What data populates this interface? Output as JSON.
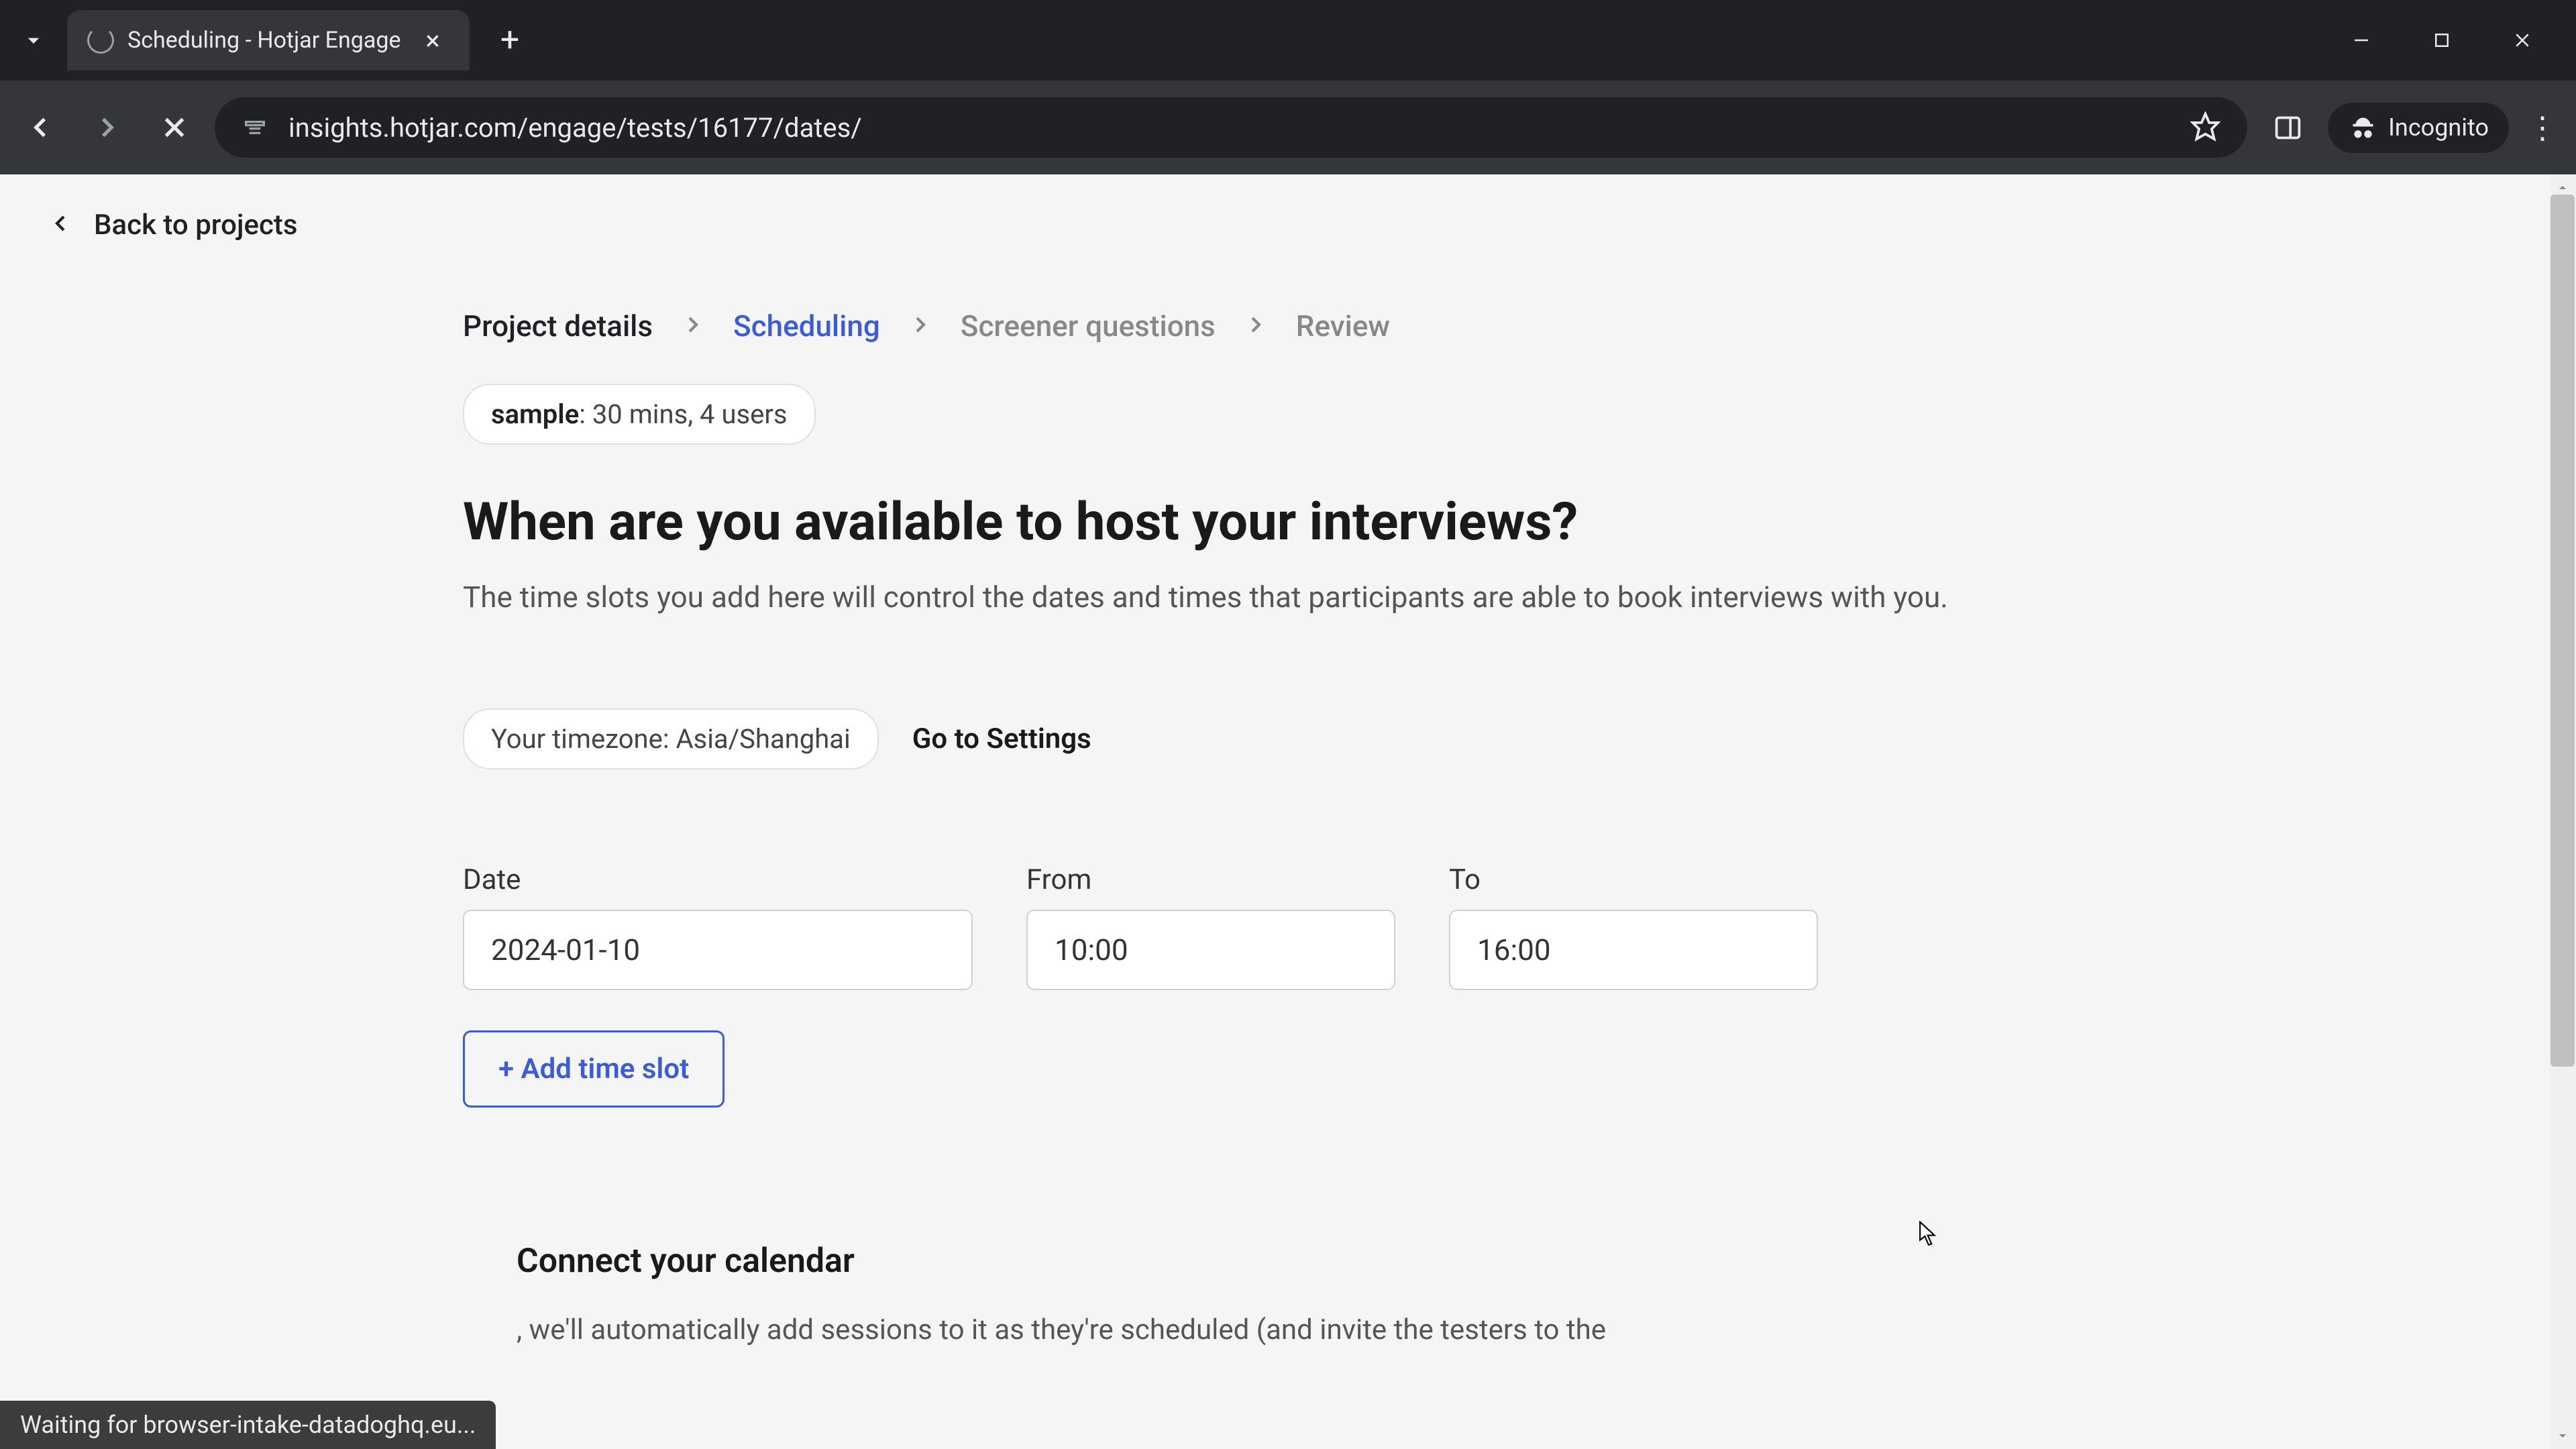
{
  "browser": {
    "tab_title": "Scheduling - Hotjar Engage",
    "url": "insights.hotjar.com/engage/tests/16177/dates/",
    "incognito_label": "Incognito",
    "status_text": "Waiting for browser-intake-datadoghq.eu..."
  },
  "header": {
    "back_label": "Back to projects"
  },
  "steps": {
    "items": [
      {
        "label": "Project details",
        "state": "done"
      },
      {
        "label": "Scheduling",
        "state": "current"
      },
      {
        "label": "Screener questions",
        "state": "future"
      },
      {
        "label": "Review",
        "state": "future"
      }
    ]
  },
  "sample_badge": {
    "prefix": "sample",
    "detail": ": 30 mins, 4 users"
  },
  "main": {
    "heading": "When are you available to host your interviews?",
    "subtext": "The time slots you add here will control the dates and times that participants are able to book interviews with you."
  },
  "timezone": {
    "label": "Your timezone: Asia/Shanghai",
    "settings_link": "Go to Settings"
  },
  "timeslot": {
    "date_label": "Date",
    "from_label": "From",
    "to_label": "To",
    "rows": [
      {
        "date": "2024-01-10",
        "from": "10:00",
        "to": "16:00"
      }
    ],
    "add_button": "+ Add time slot"
  },
  "calendar": {
    "heading": "Connect your calendar",
    "text": ", we'll automatically add sessions to it as they're scheduled (and invite the testers to the"
  },
  "colors": {
    "accent": "#3b5bdb",
    "text_primary": "#1a1a1a",
    "text_secondary": "#555",
    "border": "#d0d0d0",
    "background": "#f5f5f5"
  }
}
